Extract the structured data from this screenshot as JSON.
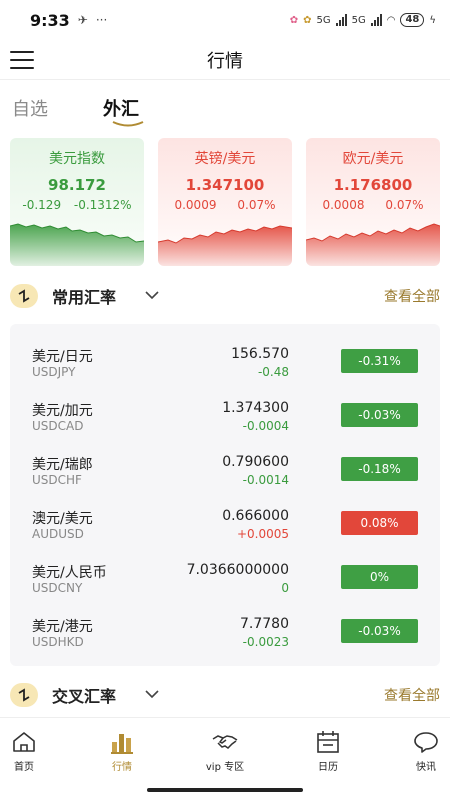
{
  "status_bar": {
    "time": "9:33",
    "dots": "···",
    "network": "5G",
    "battery": "48"
  },
  "header": {
    "title": "行情",
    "menu_icon": "hamburger-menu-icon"
  },
  "tabs": [
    {
      "label": "自选",
      "active": false
    },
    {
      "label": "外汇",
      "active": true
    }
  ],
  "cards": [
    {
      "name": "美元指数",
      "price": "98.172",
      "change": "-0.129",
      "change_pct": "-0.1312%",
      "trend": "down"
    },
    {
      "name": "英镑/美元",
      "price": "1.347100",
      "change": "0.0009",
      "change_pct": "0.07%",
      "trend": "up"
    },
    {
      "name": "欧元/美元",
      "price": "1.176800",
      "change": "0.0008",
      "change_pct": "0.07%",
      "trend": "up"
    }
  ],
  "sections": {
    "common": {
      "title": "常用汇率",
      "more": "查看全部"
    },
    "cross": {
      "title": "交叉汇率",
      "more": "查看全部"
    }
  },
  "rates": [
    {
      "name": "美元/日元",
      "code": "USDJPY",
      "price": "156.570",
      "change": "-0.48",
      "pct": "-0.31%",
      "trend": "down"
    },
    {
      "name": "美元/加元",
      "code": "USDCAD",
      "price": "1.374300",
      "change": "-0.0004",
      "pct": "-0.03%",
      "trend": "down"
    },
    {
      "name": "美元/瑞郎",
      "code": "USDCHF",
      "price": "0.790600",
      "change": "-0.0014",
      "pct": "-0.18%",
      "trend": "down"
    },
    {
      "name": "澳元/美元",
      "code": "AUDUSD",
      "price": "0.666000",
      "change": "+0.0005",
      "pct": "0.08%",
      "trend": "up"
    },
    {
      "name": "美元/人民币",
      "code": "USDCNY",
      "price": "7.0366000000",
      "change": "0",
      "pct": "0%",
      "trend": "flat"
    },
    {
      "name": "美元/港元",
      "code": "USDHKD",
      "price": "7.7780",
      "change": "-0.0023",
      "pct": "-0.03%",
      "trend": "down"
    }
  ],
  "tabbar": [
    {
      "label": "首页",
      "icon": "home-icon",
      "active": false
    },
    {
      "label": "行情",
      "icon": "bar-chart-icon",
      "active": true
    },
    {
      "label": "vip 专区",
      "icon": "handshake-icon",
      "active": false
    },
    {
      "label": "日历",
      "icon": "calendar-icon",
      "active": false
    },
    {
      "label": "快讯",
      "icon": "chat-bubble-icon",
      "active": false
    }
  ],
  "colors": {
    "up": "#e2473a",
    "down": "#3a9b3e",
    "accent": "#b08b33"
  }
}
